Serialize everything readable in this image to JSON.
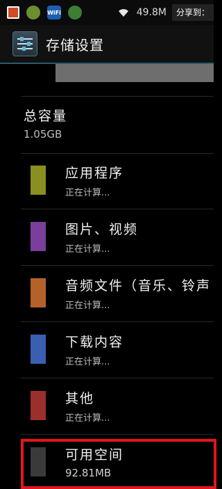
{
  "status_bar": {
    "speed": "49.8M",
    "share_label": "分享到：",
    "wifi_app_label": "WiFi"
  },
  "action_bar": {
    "title": "存储设置"
  },
  "storage_bar": {
    "used_fraction": 0.0
  },
  "total": {
    "title": "总容量",
    "value": "1.05GB"
  },
  "categories": [
    {
      "label": "应用程序",
      "sub": "正在计算...",
      "color": "#8a8f1f"
    },
    {
      "label": "图片、视频",
      "sub": "正在计算...",
      "color": "#7a3f9c"
    },
    {
      "label": "音频文件（音乐、铃声",
      "sub": "正在计算...",
      "color": "#b5622a"
    },
    {
      "label": "下载内容",
      "sub": "正在计算...",
      "color": "#3a5fb0"
    },
    {
      "label": "其他",
      "sub": "正在计算...",
      "color": "#9a2f2c"
    },
    {
      "label": "可用空间",
      "sub": "92.81MB",
      "color": "#3a3a3a"
    }
  ],
  "highlight_color": "#e0161c"
}
